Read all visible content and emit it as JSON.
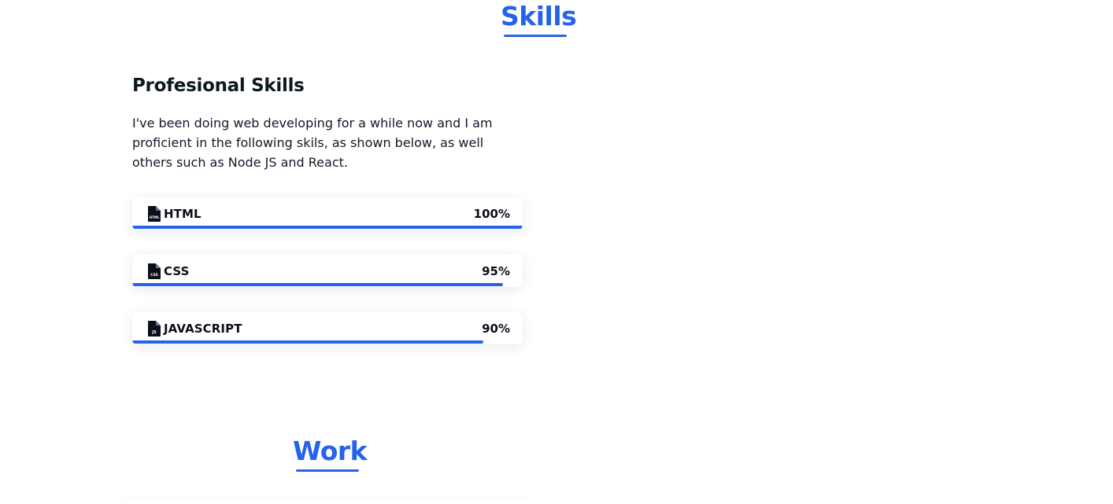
{
  "skills_section": {
    "title": "Skills",
    "subheading": "Profesional Skills",
    "description": "I've been doing web developing for a while now and I am proficient in the following skils, as shown below, as well others such as Node JS and React.",
    "items": [
      {
        "name": "HTML",
        "percent_label": "100%",
        "level": 100,
        "icon": "html-file-icon",
        "icon_text": "HTML"
      },
      {
        "name": "CSS",
        "percent_label": "95%",
        "level": 95,
        "icon": "css-file-icon",
        "icon_text": "CSS"
      },
      {
        "name": "JAVASCRIPT",
        "percent_label": "90%",
        "level": 90,
        "icon": "js-file-icon",
        "icon_text": "JS"
      }
    ]
  },
  "work_section": {
    "title": "Work"
  },
  "colors": {
    "accent": "#2563eb",
    "text": "#0b1220"
  }
}
